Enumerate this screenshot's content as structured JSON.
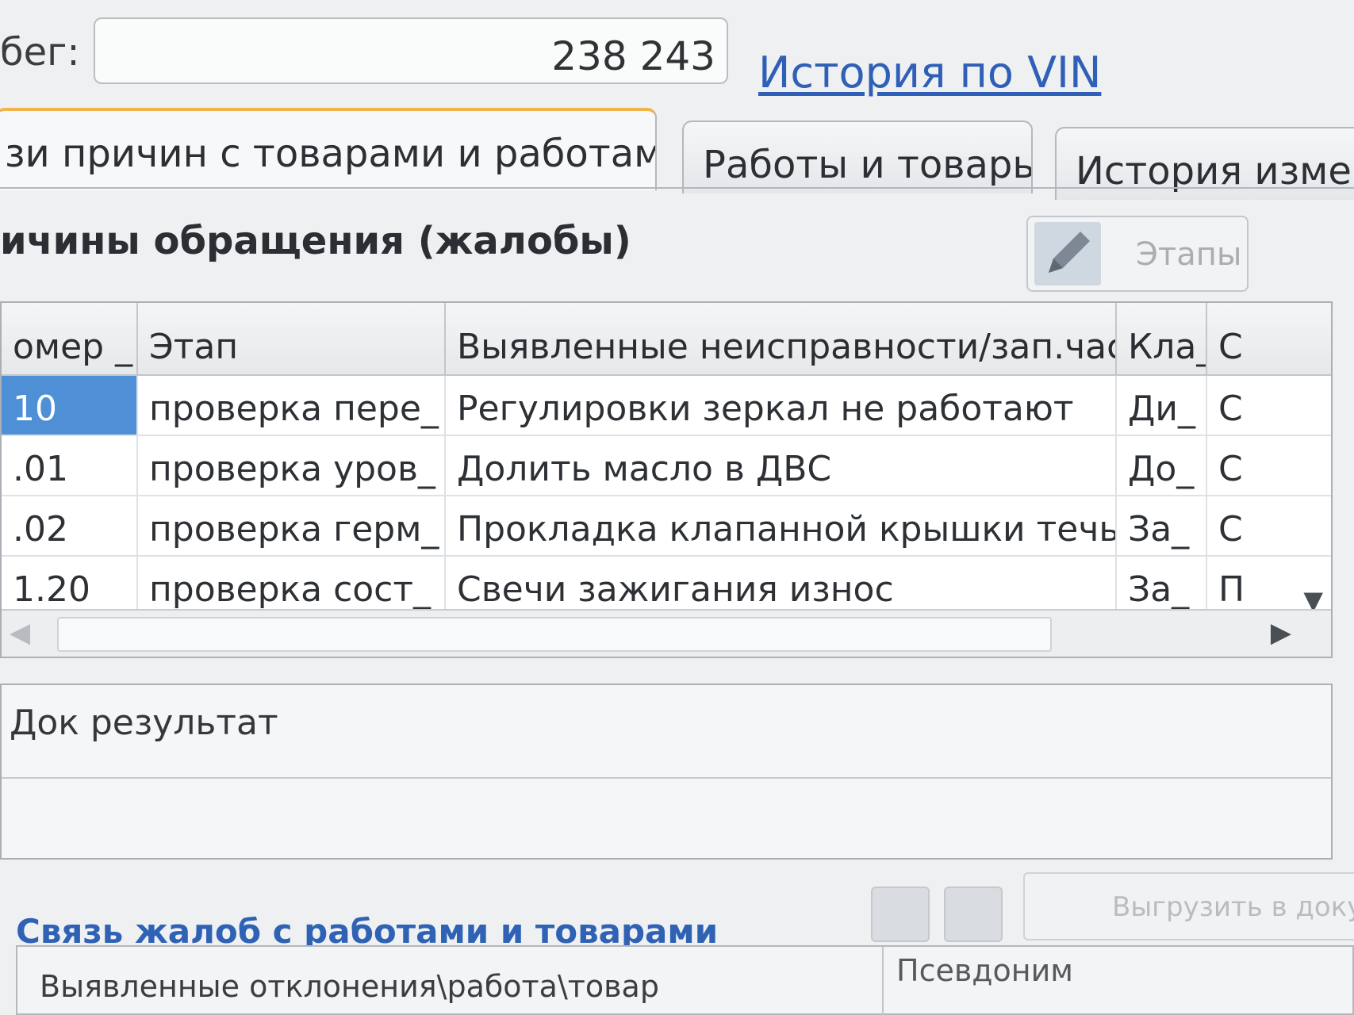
{
  "header": {
    "mileage_label": "бег:",
    "mileage_value": "238 243",
    "vin_link": "История по VIN"
  },
  "tabs": [
    {
      "label": "зи причин с товарами и работами",
      "active": true
    },
    {
      "label": "Работы и товары",
      "active": false
    },
    {
      "label": "История изменени",
      "active": false
    }
  ],
  "section": {
    "title": "ичины обращения (жалобы)",
    "stages_button": "Этапы"
  },
  "table": {
    "columns": [
      "омер _",
      "Этап",
      "Выявленные неисправности/зап.часть о_",
      "Кла_",
      "С"
    ],
    "rows": [
      [
        "10",
        "проверка пере_",
        "Регулировки зеркал не работают",
        "Ди_",
        "С"
      ],
      [
        ".01",
        "проверка уров_",
        "Долить масло в ДВС",
        "До_",
        "С"
      ],
      [
        ".02",
        "проверка герм_",
        "Прокладка клапанной крышки течь",
        "За_",
        "С"
      ],
      [
        "1.20",
        "проверка сост_",
        "Свечи зажигания износ",
        "За_",
        "П"
      ]
    ]
  },
  "doc_result": {
    "label": "Док результат"
  },
  "bottom": {
    "title": "Связь жалоб с работами и товарами",
    "export_button": "Выгрузить в докум",
    "columns": {
      "deviations": "Выявленные отклонения\\работа\\товар",
      "alias": "Псевдоним"
    }
  },
  "colors": {
    "selection": "#4f8fd6",
    "link": "#2f5fb7",
    "active_tab_accent": "#f0b44a"
  }
}
